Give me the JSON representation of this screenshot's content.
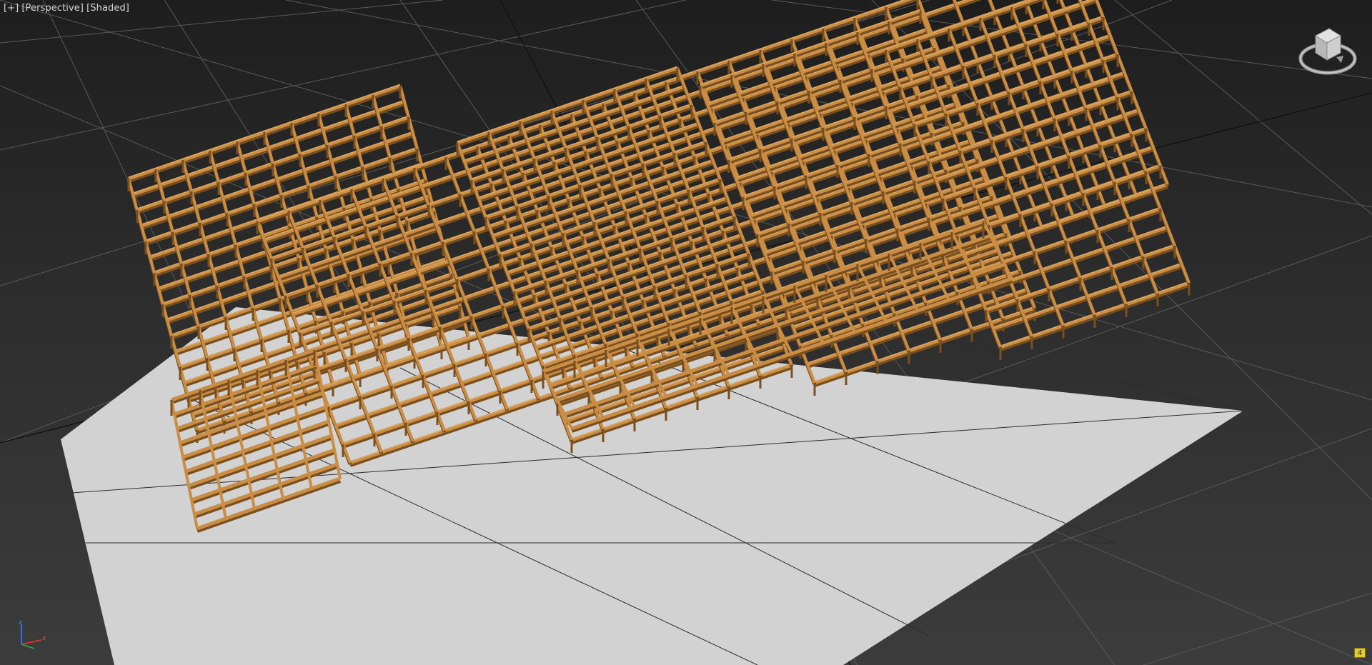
{
  "viewport": {
    "labels": {
      "plus": "[+]",
      "view": "[Perspective]",
      "shading": "[Shaded]"
    },
    "corner_badge": "4"
  },
  "icons": {
    "viewcube": "viewcube-icon",
    "axis": "axis-tripod-icon",
    "badge": "viewport-badge-icon"
  },
  "colors": {
    "background_top": "#1e1e1e",
    "background_bottom": "#3c3c3c",
    "grid_line": "#5a5a5a",
    "ground_plane": "#d2d2d2",
    "beam": "#c98d45",
    "beam_dark": "#7a4f1f",
    "beam_light": "#e0aa62",
    "badge": "#e6cc2a",
    "axis_x": "#d0342c",
    "axis_y": "#2fae3d",
    "axis_z": "#3b6fe0"
  }
}
